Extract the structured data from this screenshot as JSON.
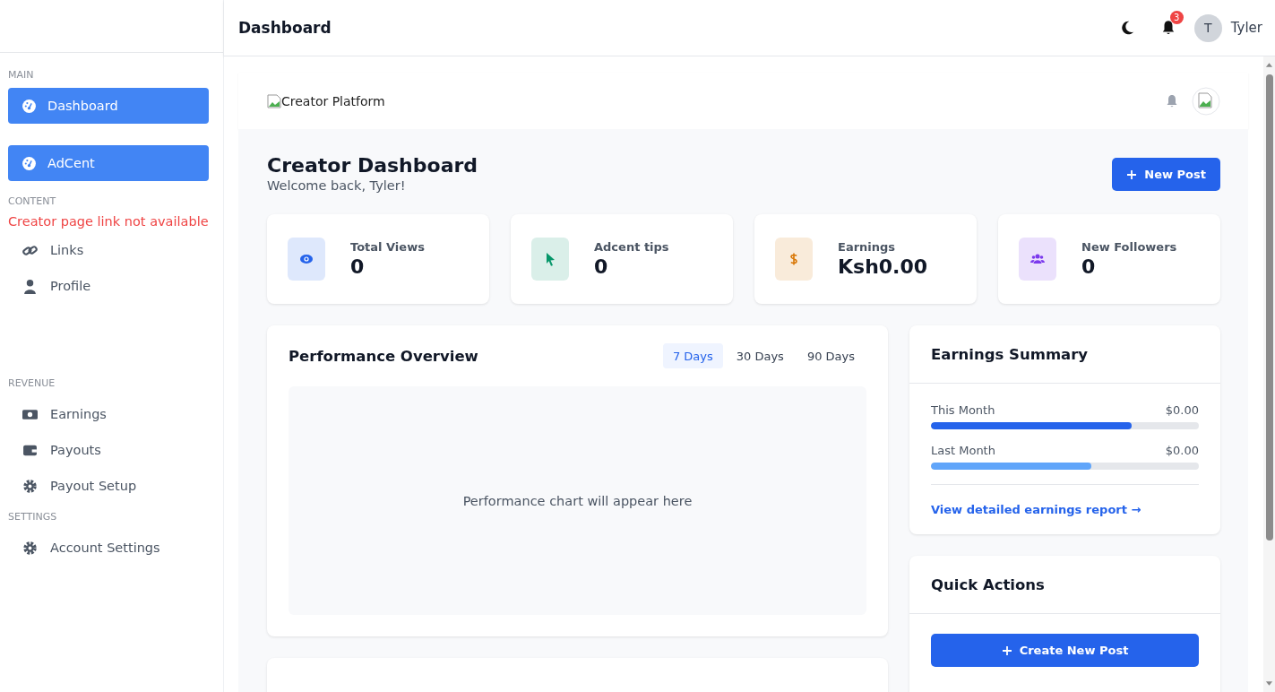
{
  "topbar": {
    "title": "Dashboard",
    "notification_count": "3",
    "user": {
      "initial": "T",
      "name": "Tyler"
    }
  },
  "sidebar": {
    "sections": [
      {
        "label": "MAIN",
        "items": [
          {
            "kind": "link",
            "label": "Dashboard",
            "selected": true
          },
          {
            "kind": "link",
            "label": "AdCent",
            "selected": true
          }
        ]
      },
      {
        "label": "CONTENT",
        "items": [
          {
            "kind": "notice",
            "label": "Creator page link not available"
          },
          {
            "kind": "link",
            "label": "Links",
            "selected": false
          },
          {
            "kind": "link",
            "label": "Profile",
            "selected": false
          }
        ]
      },
      {
        "label": "REVENUE",
        "items": [
          {
            "kind": "link",
            "label": "Earnings",
            "selected": false
          },
          {
            "kind": "link",
            "label": "Payouts",
            "selected": false
          },
          {
            "kind": "link",
            "label": "Payout Setup",
            "selected": false
          }
        ]
      },
      {
        "label": "SETTINGS",
        "items": [
          {
            "kind": "link",
            "label": "Account Settings",
            "selected": false
          }
        ]
      }
    ]
  },
  "brand_bar": {
    "logo_alt": "Creator Platform"
  },
  "header": {
    "title": "Creator Dashboard",
    "subtitle": "Welcome back, Tyler!",
    "action": "New Post"
  },
  "stats": [
    {
      "label": "Total Views",
      "value": "0",
      "color": "#2563eb"
    },
    {
      "label": "Adcent tips",
      "value": "0",
      "color": "#059669"
    },
    {
      "label": "Earnings",
      "value": "Ksh0.00",
      "color": "#d97706"
    },
    {
      "label": "New Followers",
      "value": "0",
      "color": "#7c3aed"
    }
  ],
  "performance": {
    "title": "Performance Overview",
    "tabs": [
      {
        "label": "7 Days",
        "selected": true
      },
      {
        "label": "30 Days",
        "selected": false
      },
      {
        "label": "90 Days",
        "selected": false
      }
    ],
    "placeholder": "Performance chart will appear here"
  },
  "earnings_summary": {
    "title": "Earnings Summary",
    "rows": [
      {
        "label": "This Month",
        "amount": "$0.00",
        "level": 0.75,
        "color": "#2563eb"
      },
      {
        "label": "Last Month",
        "amount": "$0.00",
        "level": 0.6,
        "color": "#60a5fa"
      }
    ],
    "link": "View detailed earnings report →"
  },
  "quick_actions": {
    "title": "Quick Actions",
    "buttons": [
      "Create New Post"
    ]
  }
}
